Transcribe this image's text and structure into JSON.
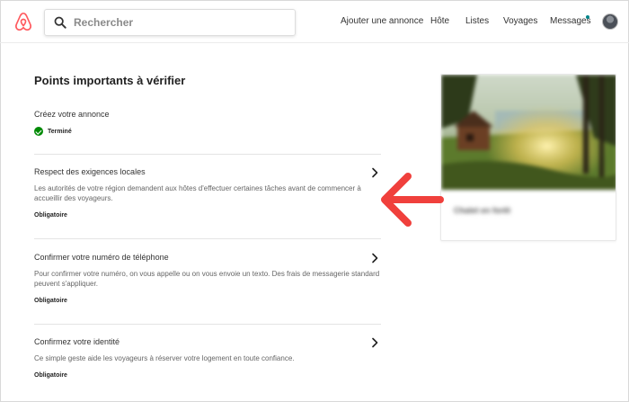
{
  "header": {
    "search_placeholder": "Rechercher",
    "nav": {
      "add_listing": "Ajouter une annonce",
      "host": "Hôte",
      "lists": "Listes",
      "trips": "Voyages",
      "messages": "Messages"
    }
  },
  "main": {
    "title": "Points importants à vérifier",
    "sections": [
      {
        "title": "Créez votre annonce",
        "status": "Terminé"
      },
      {
        "title": "Respect des exigences locales",
        "description": "Les autorités de votre région demandent aux hôtes d'effectuer certaines tâches avant de commencer à accueillir des voyageurs.",
        "status": "Obligatoire"
      },
      {
        "title": "Confirmer votre numéro de téléphone",
        "description": "Pour confirmer votre numéro, on vous appelle ou on vous envoie un texto. Des frais de messagerie standard peuvent s'appliquer.",
        "status": "Obligatoire"
      },
      {
        "title": "Confirmez votre identité",
        "description": "Ce simple geste aide les voyageurs à réserver votre logement en toute confiance.",
        "status": "Obligatoire"
      }
    ]
  },
  "listing_card": {
    "name": "Chalet en forêt"
  },
  "colors": {
    "brand": "#FF5A5F",
    "success": "#008A05",
    "accent": "#008489",
    "annotation_arrow": "#F0403C"
  },
  "icons": {
    "logo": "airbnb-logo",
    "search": "search-icon",
    "chevron": "chevron-right-icon",
    "check": "check-circle-icon"
  }
}
